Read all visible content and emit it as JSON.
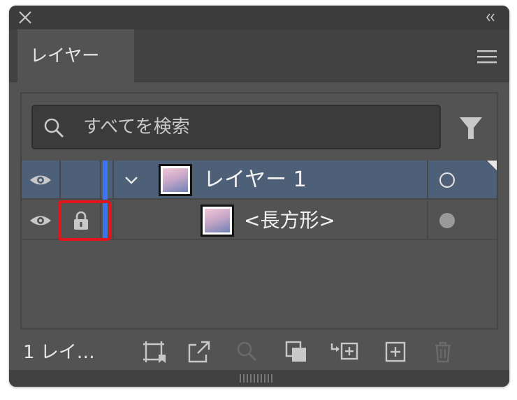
{
  "panel": {
    "tab_label": "レイヤー",
    "close_icon": "close-icon",
    "collapse_icon": "double-chevron-left-icon",
    "menu_icon": "hamburger-menu-icon"
  },
  "search": {
    "placeholder": "すべてを検索",
    "value": ""
  },
  "layers": [
    {
      "name": "レイヤー 1",
      "visible": true,
      "locked": false,
      "expanded": true,
      "color": "#3a74f2",
      "selected": true
    },
    {
      "name": "<長方形>",
      "visible": true,
      "locked": true,
      "color": "#3a74f2",
      "selected": false
    }
  ],
  "footer": {
    "count_label": "1 レイ…",
    "buttons": [
      "collect-for-export-icon",
      "export-icon",
      "locate-object-icon",
      "make-clipping-mask-icon",
      "create-sublayer-icon",
      "create-new-layer-icon",
      "delete-icon"
    ]
  },
  "colors": {
    "panel_bg": "#535353",
    "selected_row": "#4e6078",
    "layer_color": "#3a74f2",
    "highlight": "#e0151c"
  }
}
